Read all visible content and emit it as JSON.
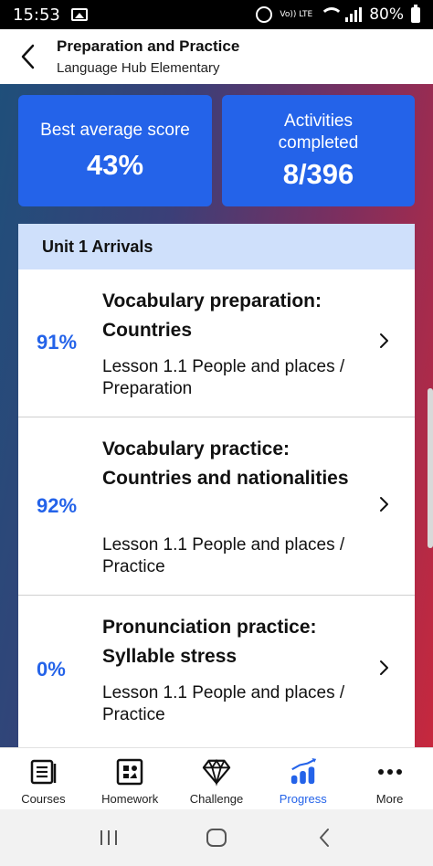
{
  "status_bar": {
    "time": "15:53",
    "volte": "Vo)) LTE",
    "battery": "80%"
  },
  "header": {
    "title": "Preparation and Practice",
    "subtitle": "Language Hub Elementary"
  },
  "stats": [
    {
      "label": "Best average score",
      "value": "43%"
    },
    {
      "label": "Activities completed",
      "value": "8/396"
    }
  ],
  "unit": {
    "title": "Unit 1 Arrivals",
    "items": [
      {
        "percent": "91%",
        "title": "Vocabulary preparation: Countries",
        "subtitle": "Lesson 1.1 People and places / Preparation"
      },
      {
        "percent": "92%",
        "title": "Vocabulary practice: Countries and nationalities",
        "subtitle": "Lesson 1.1 People and places / Practice"
      },
      {
        "percent": "0%",
        "title": "Pronunciation practice: Syllable stress",
        "subtitle": "Lesson 1.1 People and places / Practice"
      }
    ]
  },
  "nav": {
    "courses": "Courses",
    "homework": "Homework",
    "challenge": "Challenge",
    "progress": "Progress",
    "more": "More"
  },
  "colors": {
    "accent": "#2463e9",
    "unit_header": "#cfe0fb"
  }
}
